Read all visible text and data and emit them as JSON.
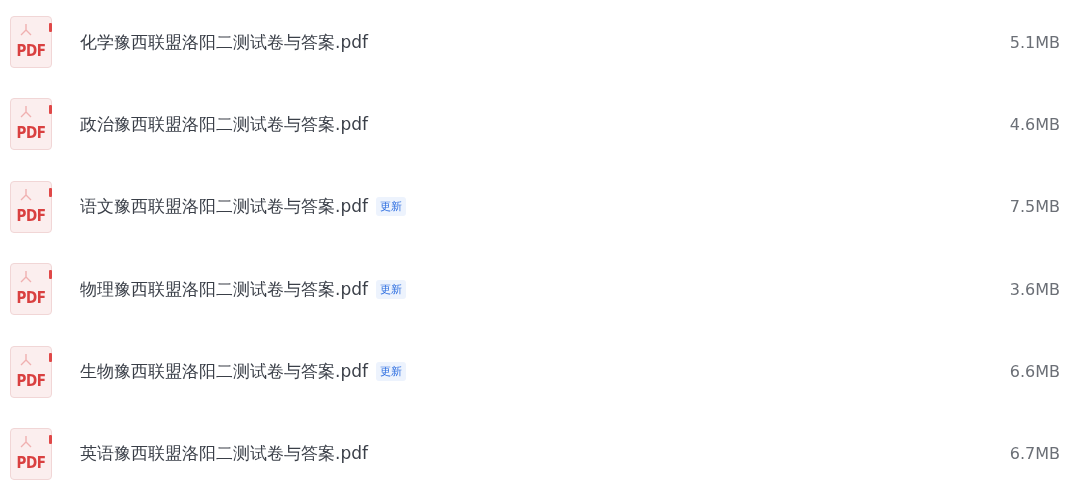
{
  "files": [
    {
      "icon_text": "PDF",
      "name": "化学豫西联盟洛阳二测试卷与答案.pdf",
      "size": "5.1MB"
    },
    {
      "icon_text": "PDF",
      "name": "政治豫西联盟洛阳二测试卷与答案.pdf",
      "size": "4.6MB"
    },
    {
      "icon_text": "PDF",
      "name": "语文豫西联盟洛阳二测试卷与答案.pdf",
      "badge": "更新",
      "size": "7.5MB"
    },
    {
      "icon_text": "PDF",
      "name": "物理豫西联盟洛阳二测试卷与答案.pdf",
      "badge": "更新",
      "size": "3.6MB"
    },
    {
      "icon_text": "PDF",
      "name": "生物豫西联盟洛阳二测试卷与答案.pdf",
      "badge": "更新",
      "size": "6.6MB"
    },
    {
      "icon_text": "PDF",
      "name": "英语豫西联盟洛阳二测试卷与答案.pdf",
      "size": "6.7MB"
    }
  ]
}
